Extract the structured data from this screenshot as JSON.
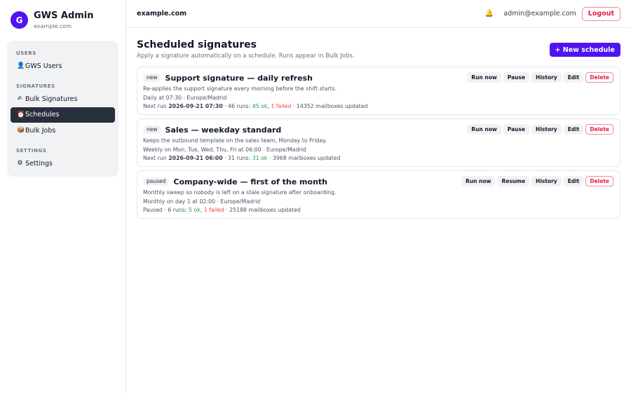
{
  "brand": {
    "initial": "G",
    "name": "GWS Admin",
    "domain": "example.com"
  },
  "nav": {
    "sections": [
      {
        "label": "USERS",
        "items": [
          {
            "icon": "👤",
            "label": "GWS Users"
          }
        ]
      },
      {
        "label": "SIGNATURES",
        "items": [
          {
            "icon": "✍",
            "label": "Bulk Signatures"
          },
          {
            "icon": "⏰",
            "label": "Schedules"
          },
          {
            "icon": "📦",
            "label": "Bulk Jobs"
          }
        ]
      },
      {
        "label": "SETTINGS",
        "items": [
          {
            "icon": "⚙",
            "label": "Settings"
          }
        ]
      }
    ],
    "active": "Schedules"
  },
  "topbar": {
    "domain": "example.com",
    "bell_icon": "🔔",
    "user_email": "admin@example.com",
    "logout_label": "Logout"
  },
  "page": {
    "title": "Scheduled signatures",
    "subtitle": "Apply a signature automatically on a schedule. Runs appear in Bulk Jobs.",
    "new_button": "+ New schedule"
  },
  "actions": {
    "run_now": "Run now",
    "pause": "Pause",
    "resume": "Resume",
    "history": "History",
    "edit": "Edit",
    "delete": "Delete"
  },
  "schedules": [
    {
      "badge": "new",
      "title": "Support signature — daily refresh",
      "description": "Re-applies the support signature every morning before the shift starts.",
      "schedule": "Daily at 07:30 · Europe/Madrid",
      "status_prefix": "Next run",
      "next_run": "2026-09-21 07:30",
      "runs": " · 46 runs: ",
      "ok": "45 ok",
      "failed": "1 failed",
      "mailboxes": " · 14352 mailboxes updated",
      "toggle": "pause"
    },
    {
      "badge": "new",
      "title": "Sales — weekday standard",
      "description": "Keeps the outbound template on the sales team, Monday to Friday.",
      "schedule": "Weekly on Mon, Tue, Wed, Thu, Fri at 06:00 · Europe/Madrid",
      "status_prefix": "Next run",
      "next_run": "2026-09-21 06:00",
      "runs": " · 31 runs: ",
      "ok": "31 ok",
      "failed": "",
      "mailboxes": " · 3968 mailboxes updated",
      "toggle": "pause"
    },
    {
      "badge": "paused",
      "title": "Company-wide — first of the month",
      "description": "Monthly sweep so nobody is left on a stale signature after onboarding.",
      "schedule": "Monthly on day 1 at 02:00 · Europe/Madrid",
      "status_prefix": "Paused",
      "next_run": "",
      "runs": " · 6 runs: ",
      "ok": "5 ok",
      "failed": "1 failed",
      "mailboxes": " · 25188 mailboxes updated",
      "toggle": "resume"
    }
  ],
  "colors": {
    "accent": "#4f14f0",
    "active_nav": "#28303d",
    "ok": "#16a34a",
    "fail": "#ef4444",
    "danger": "#e11d48"
  }
}
